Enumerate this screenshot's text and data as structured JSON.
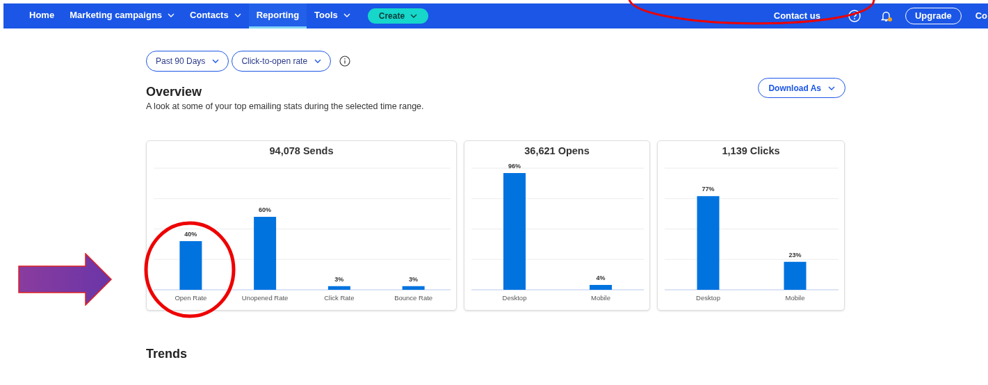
{
  "nav": {
    "items": [
      {
        "label": "Home",
        "dropdown": false,
        "selected": false
      },
      {
        "label": "Marketing campaigns",
        "dropdown": true,
        "selected": false
      },
      {
        "label": "Contacts",
        "dropdown": true,
        "selected": false
      },
      {
        "label": "Reporting",
        "dropdown": false,
        "selected": true
      },
      {
        "label": "Tools",
        "dropdown": true,
        "selected": false
      }
    ],
    "create_button": "Create",
    "contact_link": "Contact us",
    "upgrade_button": "Upgrade",
    "cut_item": "Co"
  },
  "filters": [
    {
      "label": "Past 90 Days"
    },
    {
      "label": "Click-to-open rate"
    }
  ],
  "overview": {
    "title": "Overview",
    "subtitle": "A look at some of your top emailing stats during the selected time range.",
    "download_button": "Download As"
  },
  "cards": [
    {
      "title": "94,078 Sends",
      "chart_data": {
        "type": "bar",
        "categories": [
          "Open Rate",
          "Unopened Rate",
          "Click Rate",
          "Bounce Rate"
        ],
        "values": [
          40,
          60,
          3,
          3
        ],
        "value_labels": [
          "40%",
          "60%",
          "3%",
          "3%"
        ],
        "ylim": [
          0,
          100
        ]
      }
    },
    {
      "title": "36,621 Opens",
      "chart_data": {
        "type": "bar",
        "categories": [
          "Desktop",
          "Mobile"
        ],
        "values": [
          96,
          4
        ],
        "value_labels": [
          "96%",
          "4%"
        ],
        "ylim": [
          0,
          100
        ]
      }
    },
    {
      "title": "1,139 Clicks",
      "chart_data": {
        "type": "bar",
        "categories": [
          "Desktop",
          "Mobile"
        ],
        "values": [
          77,
          23
        ],
        "value_labels": [
          "77%",
          "23%"
        ],
        "ylim": [
          0,
          100
        ]
      }
    }
  ],
  "trends_title": "Trends"
}
